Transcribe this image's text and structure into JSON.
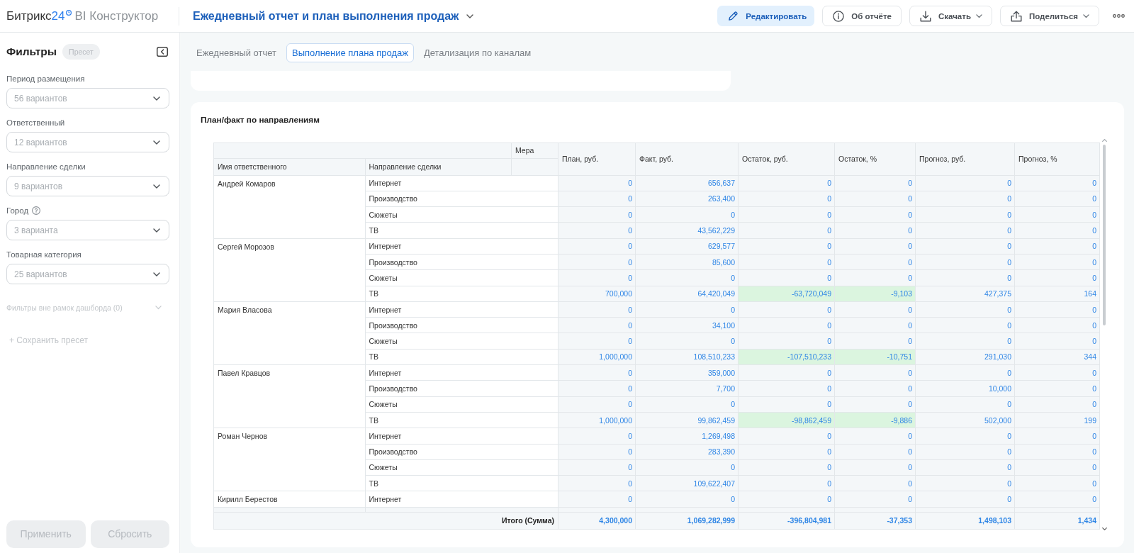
{
  "header": {
    "logo": {
      "brand": "Битрикс",
      "brand_number": "24",
      "product": "BI Конструктор"
    },
    "title": "Ежедневный отчет и план выполнения продаж",
    "actions": [
      {
        "kind": "edit",
        "label": "Редактировать",
        "dropdown": false
      },
      {
        "kind": "about",
        "label": "Об отчёте",
        "dropdown": false
      },
      {
        "kind": "download",
        "label": "Скачать",
        "dropdown": true
      },
      {
        "kind": "share",
        "label": "Поделиться",
        "dropdown": true
      }
    ]
  },
  "sidebar": {
    "title": "Фильтры",
    "badge": "Пресет",
    "filters": [
      {
        "label": "Период размещения",
        "placeholder": "56 вариантов",
        "help": false
      },
      {
        "label": "Ответственный",
        "placeholder": "12 вариантов",
        "help": false
      },
      {
        "label": "Направление сделки",
        "placeholder": "9 вариантов",
        "help": false
      },
      {
        "label": "Город",
        "placeholder": "3 варианта",
        "help": true
      },
      {
        "label": "Товарная категория",
        "placeholder": "25 вариантов",
        "help": false
      }
    ],
    "outside_filters": {
      "label": "Фильтры вне рамок дашборда (0)",
      "disabled": true
    },
    "save_preset": {
      "label": "+ Сохранить пресет",
      "disabled": true
    },
    "buttons": [
      {
        "label": "Применить",
        "disabled": true
      },
      {
        "label": "Сбросить",
        "disabled": true
      }
    ]
  },
  "tabs": [
    {
      "label": "Ежедневный отчет",
      "selected": false
    },
    {
      "label": "Выполнение плана продаж",
      "selected": true
    },
    {
      "label": "Детализация по каналам",
      "selected": false
    }
  ],
  "report": {
    "title": "План/факт по направлениям",
    "table": {
      "measure_label": "Мера",
      "row_headers": [
        "Имя ответственного",
        "Направление сделки"
      ],
      "columns": [
        {
          "label": "План, руб.",
          "highlight": false
        },
        {
          "label": "Факт, руб.",
          "highlight": false
        },
        {
          "label": "Остаток, руб.",
          "highlight": true
        },
        {
          "label": "Остаток, %",
          "highlight": true
        },
        {
          "label": "Прогноз, руб.",
          "highlight": false
        },
        {
          "label": "Прогноз, %",
          "highlight": false
        }
      ],
      "groups": [
        {
          "name": "Андрей Комаров",
          "rows": [
            {
              "direction": "Интернет",
              "values": [
                "0",
                "656,637",
                "0",
                "0",
                "0",
                "0"
              ],
              "highlighted": false
            },
            {
              "direction": "Производство",
              "values": [
                "0",
                "263,400",
                "0",
                "0",
                "0",
                "0"
              ],
              "highlighted": false
            },
            {
              "direction": "Сюжеты",
              "values": [
                "0",
                "0",
                "0",
                "0",
                "0",
                "0"
              ],
              "highlighted": false
            },
            {
              "direction": "ТВ",
              "values": [
                "0",
                "43,562,229",
                "0",
                "0",
                "0",
                "0"
              ],
              "highlighted": false
            }
          ]
        },
        {
          "name": "Сергей Морозов",
          "rows": [
            {
              "direction": "Интернет",
              "values": [
                "0",
                "629,577",
                "0",
                "0",
                "0",
                "0"
              ],
              "highlighted": false
            },
            {
              "direction": "Производство",
              "values": [
                "0",
                "85,600",
                "0",
                "0",
                "0",
                "0"
              ],
              "highlighted": false
            },
            {
              "direction": "Сюжеты",
              "values": [
                "0",
                "0",
                "0",
                "0",
                "0",
                "0"
              ],
              "highlighted": false
            },
            {
              "direction": "ТВ",
              "values": [
                "700,000",
                "64,420,049",
                "-63,720,049",
                "-9,103",
                "427,375",
                "164"
              ],
              "highlighted": true
            }
          ]
        },
        {
          "name": "Мария Власова",
          "rows": [
            {
              "direction": "Интернет",
              "values": [
                "0",
                "0",
                "0",
                "0",
                "0",
                "0"
              ],
              "highlighted": false
            },
            {
              "direction": "Производство",
              "values": [
                "0",
                "34,100",
                "0",
                "0",
                "0",
                "0"
              ],
              "highlighted": false
            },
            {
              "direction": "Сюжеты",
              "values": [
                "0",
                "0",
                "0",
                "0",
                "0",
                "0"
              ],
              "highlighted": false
            },
            {
              "direction": "ТВ",
              "values": [
                "1,000,000",
                "108,510,233",
                "-107,510,233",
                "-10,751",
                "291,030",
                "344"
              ],
              "highlighted": true
            }
          ]
        },
        {
          "name": "Павел Кравцов",
          "rows": [
            {
              "direction": "Интернет",
              "values": [
                "0",
                "359,000",
                "0",
                "0",
                "0",
                "0"
              ],
              "highlighted": false
            },
            {
              "direction": "Производство",
              "values": [
                "0",
                "7,700",
                "0",
                "0",
                "10,000",
                "0"
              ],
              "highlighted": false
            },
            {
              "direction": "Сюжеты",
              "values": [
                "0",
                "0",
                "0",
                "0",
                "0",
                "0"
              ],
              "highlighted": false
            },
            {
              "direction": "ТВ",
              "values": [
                "1,000,000",
                "99,862,459",
                "-98,862,459",
                "-9,886",
                "502,000",
                "199"
              ],
              "highlighted": true
            }
          ]
        },
        {
          "name": "Роман Чернов",
          "rows": [
            {
              "direction": "Интернет",
              "values": [
                "0",
                "1,269,498",
                "0",
                "0",
                "0",
                "0"
              ],
              "highlighted": false
            },
            {
              "direction": "Производство",
              "values": [
                "0",
                "283,390",
                "0",
                "0",
                "0",
                "0"
              ],
              "highlighted": false
            },
            {
              "direction": "Сюжеты",
              "values": [
                "0",
                "0",
                "0",
                "0",
                "0",
                "0"
              ],
              "highlighted": false
            },
            {
              "direction": "ТВ",
              "values": [
                "0",
                "109,622,407",
                "0",
                "0",
                "0",
                "0"
              ],
              "highlighted": false
            }
          ]
        },
        {
          "name": "Кирилл Берестов",
          "rows": [
            {
              "direction": "Интернет",
              "values": [
                "0",
                "0",
                "0",
                "0",
                "0",
                "0"
              ],
              "highlighted": false
            }
          ]
        }
      ],
      "total": {
        "label": "Итого (Сумма)",
        "values": [
          "4,300,000",
          "1,069,282,999",
          "-396,804,981",
          "-37,353",
          "1,498,103",
          "1,434"
        ]
      }
    }
  }
}
